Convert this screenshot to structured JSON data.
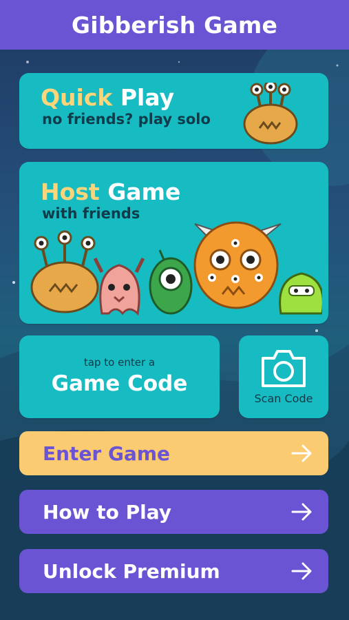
{
  "header": {
    "title": "Gibberish Game"
  },
  "quick_play": {
    "title_accent": "Quick",
    "title_rest": " Play",
    "subtitle": "no friends? play solo"
  },
  "host_game": {
    "title_accent": "Host",
    "title_rest": " Game",
    "subtitle": "with friends"
  },
  "game_code": {
    "hint": "tap to enter a",
    "label": "Game Code"
  },
  "scan_code": {
    "label": "Scan Code",
    "icon": "camera-icon"
  },
  "buttons": {
    "enter_game": "Enter Game",
    "how_to_play": "How to Play",
    "unlock_premium": "Unlock Premium"
  },
  "colors": {
    "header": "#6a54d4",
    "card": "#17bcc3",
    "accent_text": "#fcd47a",
    "enter_button": "#fbcb72",
    "purple_button": "#6a54d4"
  }
}
